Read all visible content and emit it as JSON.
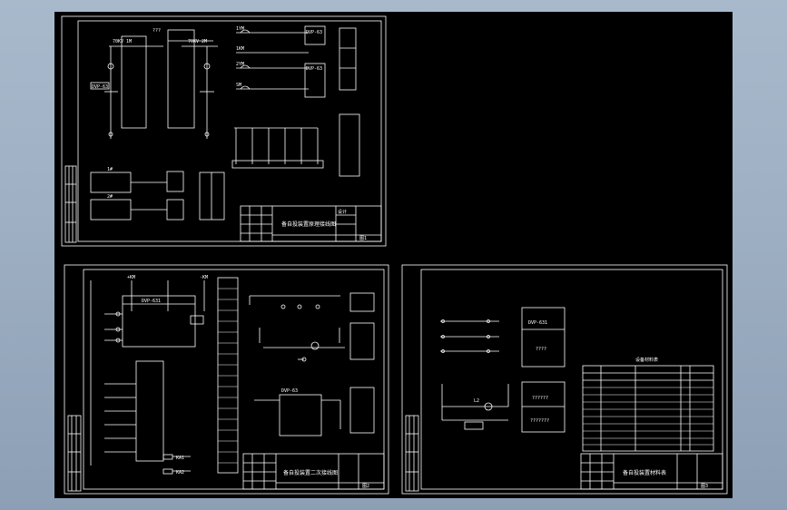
{
  "app": {
    "background_color": "#a3b4c8",
    "canvas_color": "#000000",
    "line_color": "#ffffff",
    "accent_color": "#7fffff"
  },
  "sheets": [
    {
      "name": "sheet-1",
      "labels": {
        "bus_left": "70KV 1M",
        "bus_right": "70KV 2M",
        "bus_mid": "???",
        "relay_a": "1YM",
        "relay_b": "2YM",
        "relay_c": "SM",
        "relay_d": "1KM",
        "device_main": "DVP-63",
        "device_second": "DVP-63",
        "device_third": "DVP-63",
        "terminal_1": "1#",
        "terminal_2": "2#",
        "title_text": "备自投装置原理接线图",
        "table_label": "设计",
        "sheet_no": "图1"
      }
    },
    {
      "name": "sheet-2",
      "labels": {
        "bus_a": "+KM",
        "bus_b": "-KM",
        "device_main": "DVP-631",
        "device_second": "DVP-63",
        "coil_a": "KA1",
        "coil_b": "KA2",
        "title_text": "备自投装置二次接线图",
        "sheet_no": "图2"
      }
    },
    {
      "name": "sheet-3",
      "labels": {
        "device_main": "DVP-631",
        "device_box_1": "????",
        "device_box_2": "??????",
        "device_box_3": "???????",
        "coil": "L2",
        "table_title": "设备材料表",
        "title_text": "备自投装置材料表",
        "sheet_no": "图3"
      }
    }
  ]
}
